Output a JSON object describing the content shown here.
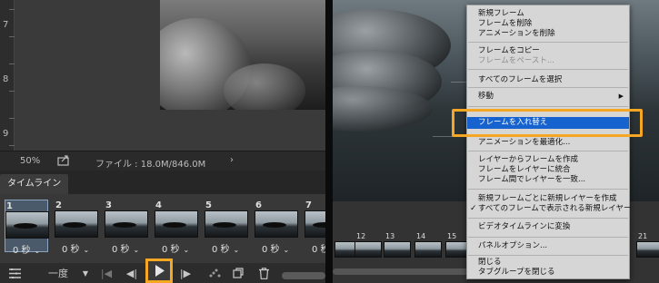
{
  "left": {
    "ruler_numbers": [
      "7",
      "8",
      "9"
    ],
    "zoom": "50%",
    "file_info": "ファイル : 18.0M/846.0M",
    "status_arrow": "›",
    "timeline_tab": "タイムライン",
    "frames": [
      {
        "num": "1",
        "delay": "0 秒",
        "selected": true
      },
      {
        "num": "2",
        "delay": "0 秒"
      },
      {
        "num": "3",
        "delay": "0 秒"
      },
      {
        "num": "4",
        "delay": "0 秒"
      },
      {
        "num": "5",
        "delay": "0 秒"
      },
      {
        "num": "6",
        "delay": "0 秒"
      },
      {
        "num": "7",
        "delay": "0 秒"
      }
    ],
    "loop_label": "一度",
    "icons": {
      "panel_menu": "list-icon",
      "first": "first-frame-icon",
      "prev": "prev-frame-icon",
      "play": "play-icon",
      "next": "next-frame-icon",
      "tween": "tween-icon",
      "duplicate": "new-frame-icon",
      "trash": "trash-icon"
    }
  },
  "right": {
    "frame_numbers": [
      "",
      "12",
      "13",
      "14",
      "15",
      "16",
      "17",
      "18",
      "19",
      "20",
      "21"
    ]
  },
  "menu": {
    "items": [
      "新規フレーム",
      "フレームを削除",
      "アニメーションを削除",
      "フレームをコピー",
      "フレームをペースト...",
      "すべてのフレームを選択",
      "移動",
      "フレームを入れ替え",
      "アニメーションを最適化...",
      "レイヤーからフレームを作成",
      "フレームをレイヤーに統合",
      "フレーム間でレイヤーを一致...",
      "新規フレームごとに新規レイヤーを作成",
      "すべてのフレームで表示される新規レイヤー",
      "ビデオタイムラインに変換",
      "パネルオプション...",
      "閉じる",
      "タブグループを閉じる"
    ],
    "submenu_arrow": "▶",
    "checkmark": "✓"
  },
  "colors": {
    "highlight_box": "#f5a623",
    "menu_selection": "#1662cf"
  }
}
